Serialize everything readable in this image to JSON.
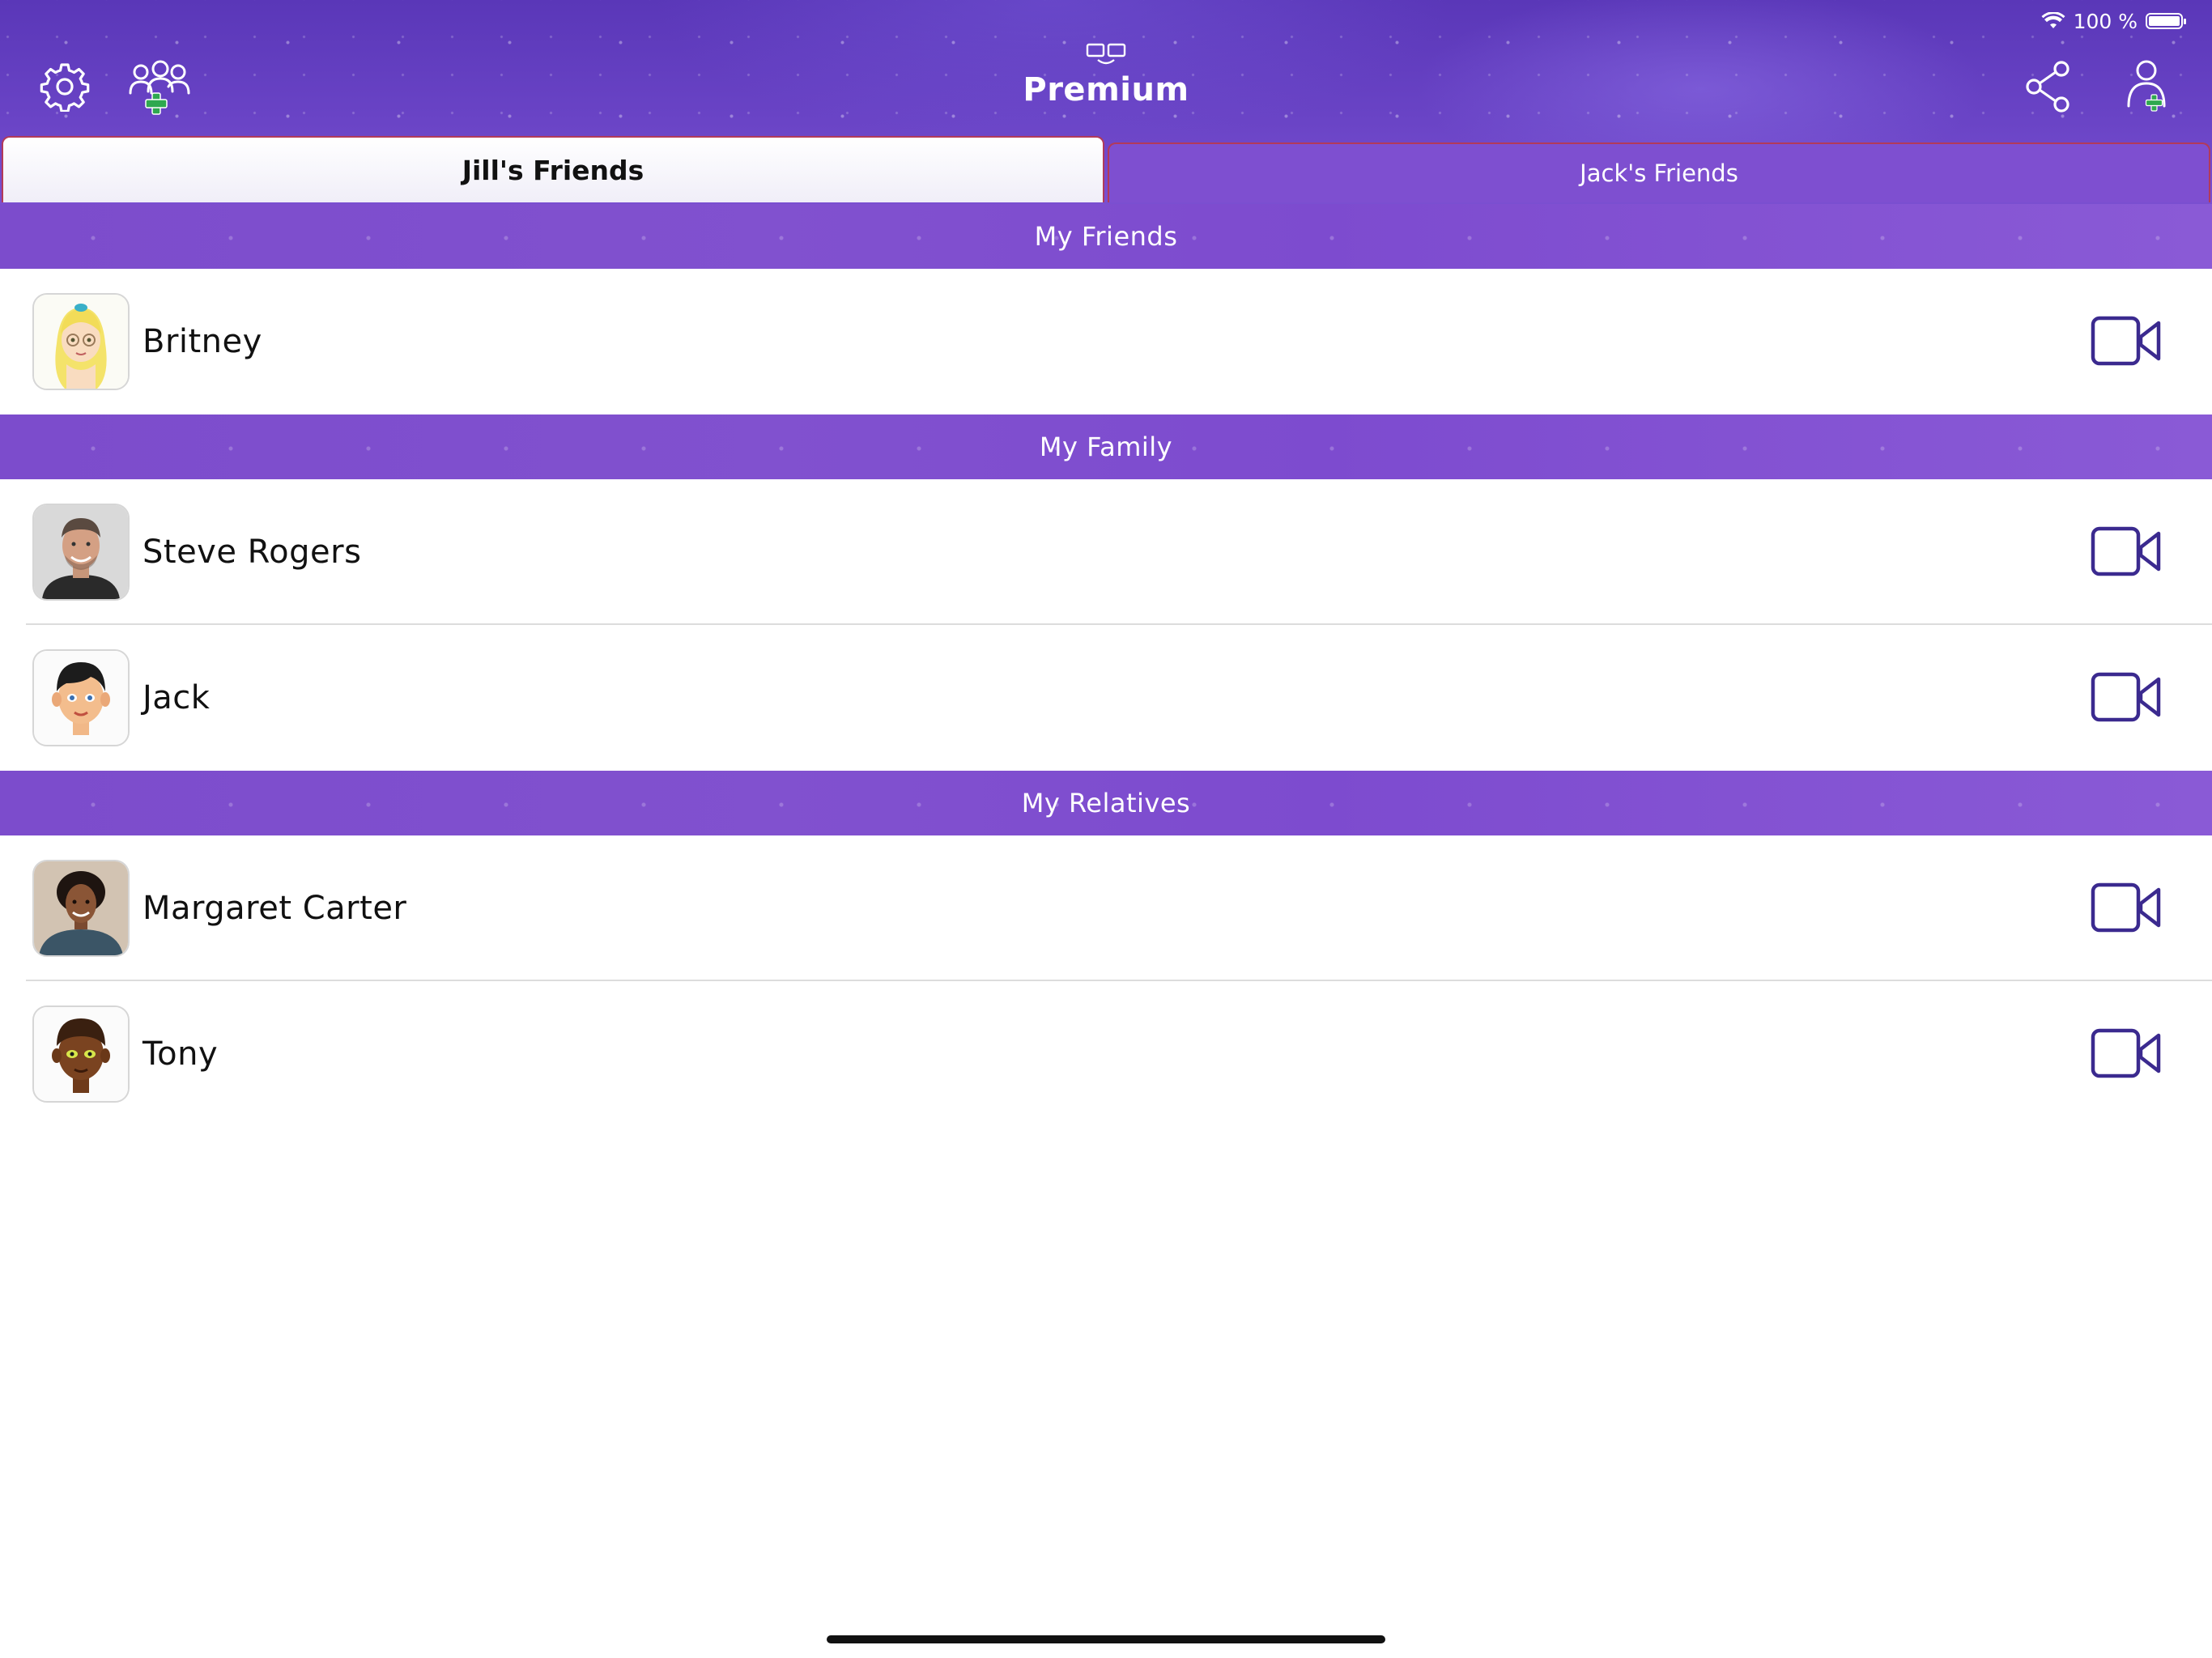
{
  "status_bar": {
    "battery_text": "100 %"
  },
  "header": {
    "premium_label": "Premium"
  },
  "tabs": [
    {
      "label": "Jill's Friends",
      "active": true
    },
    {
      "label": "Jack's Friends",
      "active": false
    }
  ],
  "sections": [
    {
      "title": "My Friends",
      "contacts": [
        {
          "name": "Britney",
          "avatar": "cartoon-blonde-girl-avatar"
        }
      ]
    },
    {
      "title": "My Family",
      "contacts": [
        {
          "name": "Steve Rogers",
          "avatar": "man-photo-avatar"
        },
        {
          "name": "Jack",
          "avatar": "cartoon-boy-avatar"
        }
      ]
    },
    {
      "title": "My Relatives",
      "contacts": [
        {
          "name": "Margaret Carter",
          "avatar": "woman-photo-avatar"
        },
        {
          "name": "Tony",
          "avatar": "cartoon-boy-dark-avatar"
        }
      ]
    }
  ],
  "colors": {
    "header_purple": "#6a44c6",
    "section_purple": "#7c4ccc",
    "tab_border": "#b23a5a",
    "video_icon": "#3b2a8f",
    "add_green": "#2fa84f"
  },
  "icons": {
    "settings": "gear-icon",
    "add_group": "add-group-icon",
    "premium": "premium-icon",
    "share": "share-icon",
    "add_user": "add-user-icon",
    "video_call": "video-camera-icon"
  }
}
